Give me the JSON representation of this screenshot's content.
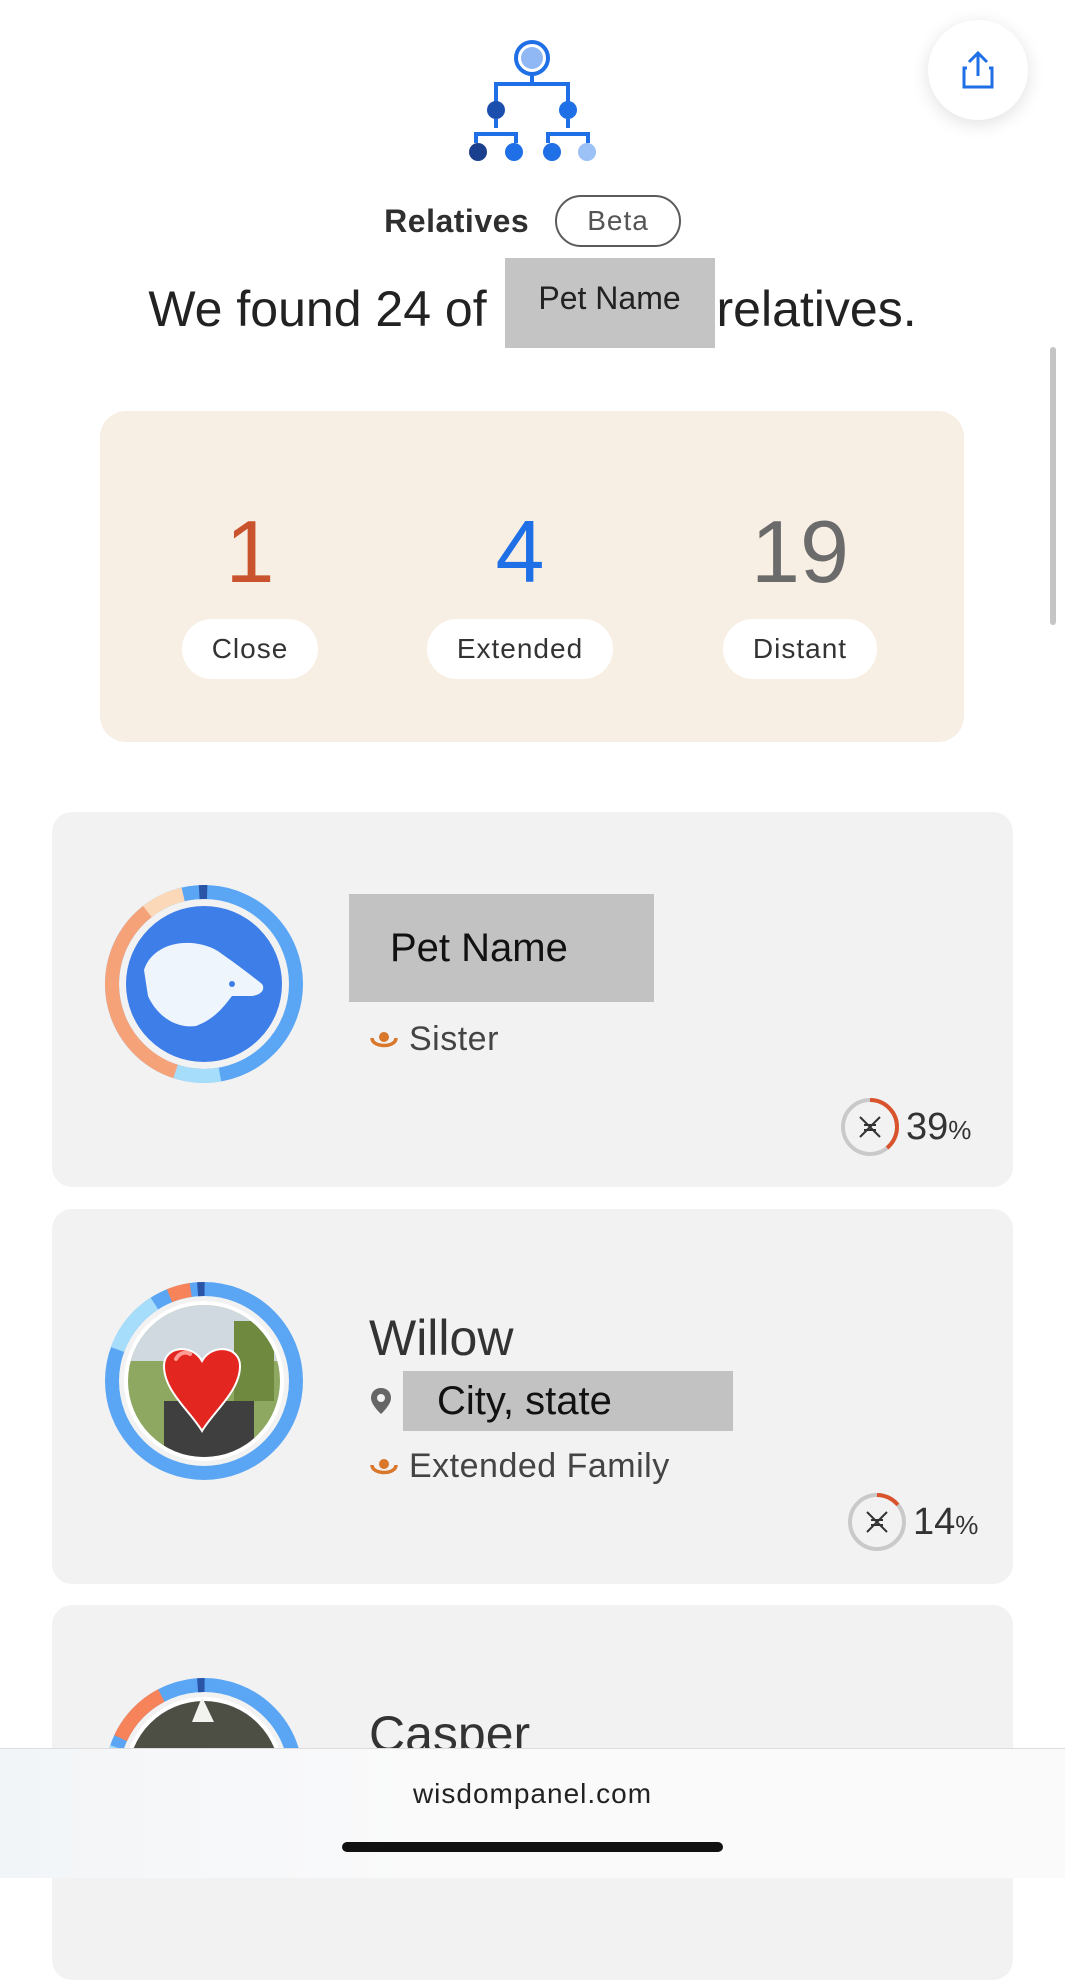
{
  "header": {
    "section_title": "Relatives",
    "badge": "Beta",
    "headline_before": "We found 24 of",
    "headline_redacted": "Pet Name",
    "headline_after": "relatives."
  },
  "summary": [
    {
      "value": "1",
      "label": "Close",
      "color": "#c9532c"
    },
    {
      "value": "4",
      "label": "Extended",
      "color": "#1f6fe6"
    },
    {
      "value": "19",
      "label": "Distant",
      "color": "#6b6b6b"
    }
  ],
  "relatives": [
    {
      "name": "Pet Name",
      "name_redacted": true,
      "relation": "Sister",
      "dna_percent": "39",
      "dna_fraction": 0.39
    },
    {
      "name": "Willow",
      "location": "City, state",
      "relation": "Extended Family",
      "dna_percent": "14",
      "dna_fraction": 0.14
    },
    {
      "name": "Casper"
    }
  ],
  "percent_symbol": "%",
  "footer": {
    "domain": "wisdompanel.com"
  },
  "colors": {
    "accent": "#1f6fe6",
    "relation_icon": "#d9772a",
    "dna_ring": "#d9532c"
  }
}
